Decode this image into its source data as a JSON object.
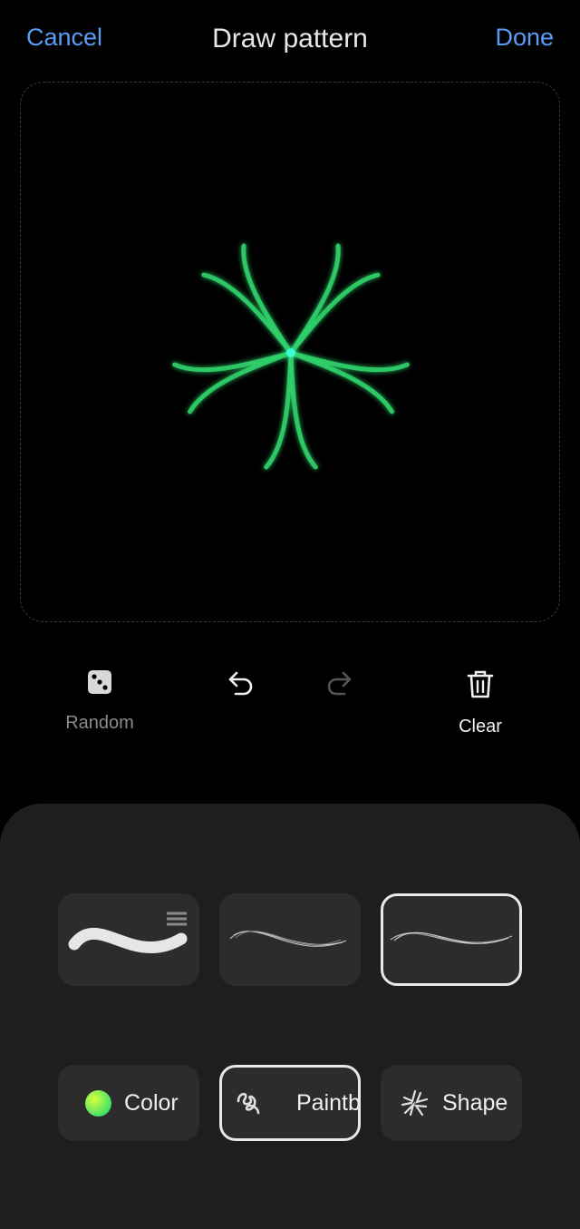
{
  "header": {
    "cancel_label": "Cancel",
    "title": "Draw pattern",
    "done_label": "Done",
    "accent_color": "#5b9cf5"
  },
  "canvas": {
    "pattern_color": "#2fd06a",
    "pattern_center_color": "#39ffd8",
    "pattern_petals": 5
  },
  "toolbar": {
    "random_label": "Random",
    "random_icon": "dice-icon",
    "undo_icon": "undo-icon",
    "redo_icon": "redo-icon",
    "clear_label": "Clear",
    "clear_icon": "trash-icon"
  },
  "brushes": [
    {
      "icon": "solid-stroke-brush-icon",
      "selected": false,
      "has_menu": true
    },
    {
      "icon": "ribbon-stroke-brush-icon",
      "selected": false
    },
    {
      "icon": "fine-ribbon-brush-icon",
      "selected": true
    }
  ],
  "tabs": {
    "color_label": "Color",
    "color_swatch": [
      "#d8ff3a",
      "#3ae06a"
    ],
    "paint_label": "Paintbrush",
    "paint_icon": "squiggle-icon",
    "shape_label": "Shape",
    "shape_icon": "sparkle-shape-icon",
    "selected": "paint"
  }
}
